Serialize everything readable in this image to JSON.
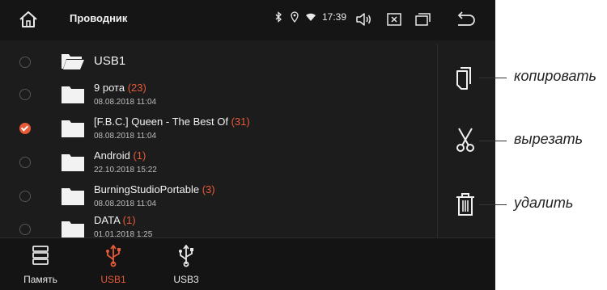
{
  "header": {
    "title": "Проводник",
    "time": "17:39"
  },
  "root": {
    "label": "USB1"
  },
  "folders": [
    {
      "name": "9 рота",
      "count": "(23)",
      "date": "08.08.2018 11:04",
      "checked": false
    },
    {
      "name": "[F.B.C.] Queen - The Best Of",
      "count": "(31)",
      "date": "08.08.2018 11:04",
      "checked": true
    },
    {
      "name": "Android",
      "count": "(1)",
      "date": "22.10.2018 15:22",
      "checked": false
    },
    {
      "name": "BurningStudioPortable",
      "count": "(3)",
      "date": "08.08.2018 11:04",
      "checked": false
    },
    {
      "name": "DATA",
      "count": "(1)",
      "date": "01.01.2018 1:25",
      "checked": false
    }
  ],
  "bottom": {
    "memory": "Память",
    "usb1": "USB1",
    "usb3": "USB3"
  },
  "callouts": {
    "copy": "копировать",
    "cut": "вырезать",
    "delete": "удалить"
  },
  "colors": {
    "accent": "#e65a38",
    "screen": "#1c1c1c"
  }
}
